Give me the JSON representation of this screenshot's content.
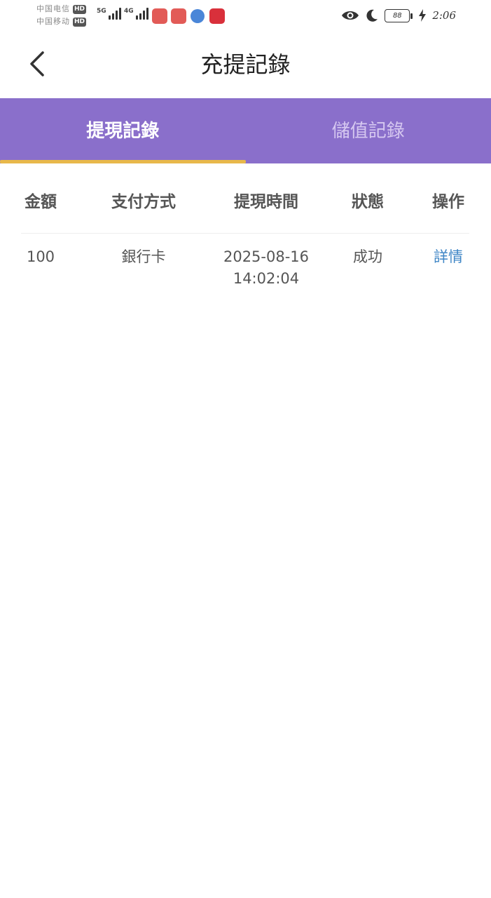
{
  "status_bar": {
    "carrier_1": "中国电信",
    "carrier_2": "中国移动",
    "hd_badge": "HD",
    "network_1": "5G",
    "network_2": "4G",
    "battery": "88",
    "time": "2:06",
    "icons": [
      "eye-icon",
      "moon-icon",
      "charging-bolt-icon"
    ]
  },
  "header": {
    "title": "充提記錄",
    "back_icon": "chevron-left-icon"
  },
  "tabs": [
    {
      "label": "提現記錄",
      "active": true
    },
    {
      "label": "儲值記錄",
      "active": false
    }
  ],
  "table": {
    "columns": [
      "金額",
      "支付方式",
      "提現時間",
      "狀態",
      "操作"
    ],
    "rows": [
      {
        "amount": "100",
        "method": "銀行卡",
        "date": "2025-08-16",
        "time": "14:02:04",
        "status": "成功",
        "action": "詳情"
      }
    ]
  },
  "colors": {
    "tab_bar": "#8a6fcb",
    "tab_indicator": "#e8b84a",
    "link": "#3f86c6"
  }
}
